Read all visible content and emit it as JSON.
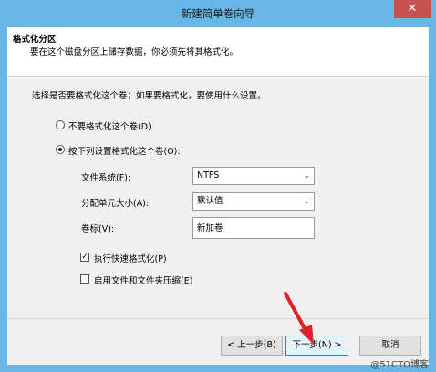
{
  "window": {
    "title": "新建简单卷向导",
    "close_label": "✕"
  },
  "header": {
    "title": "格式化分区",
    "subtitle": "要在这个磁盘分区上储存数据，你必须先将其格式化。"
  },
  "body": {
    "prompt": "选择是否要格式化这个卷；如果要格式化，要使用什么设置。",
    "option_no_format": {
      "label": "不要格式化这个卷(D)",
      "selected": false
    },
    "option_format": {
      "label": "按下列设置格式化这个卷(O):",
      "selected": true
    },
    "filesystem": {
      "label": "文件系统(F):",
      "value": "NTFS"
    },
    "allocation": {
      "label": "分配单元大小(A):",
      "value": "默认值"
    },
    "volume_label": {
      "label": "卷标(V):",
      "value": "新加卷"
    },
    "quick_format": {
      "label": "执行快速格式化(P)",
      "checked": true
    },
    "compression": {
      "label": "启用文件和文件夹压缩(E)",
      "checked": false
    }
  },
  "footer": {
    "back_label": "< 上一步(B)",
    "next_label": "下一步(N) >",
    "cancel_label": "取消"
  },
  "watermark": "@51CTO博客",
  "colors": {
    "titlebar": "#67b7e6",
    "close": "#c75050",
    "arrow": "#e0202a"
  }
}
